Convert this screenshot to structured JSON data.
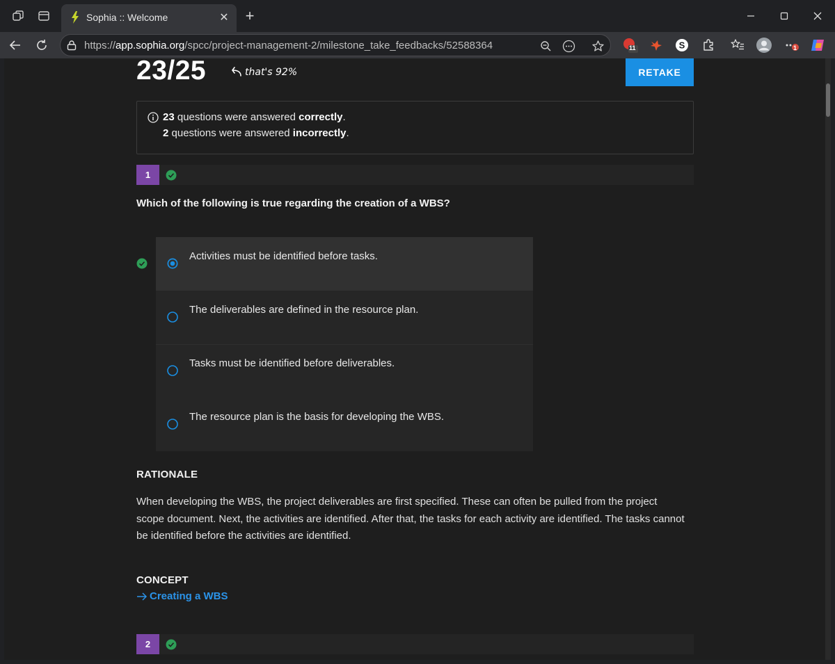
{
  "browser": {
    "tab_title": "Sophia :: Welcome",
    "url_prefix": "https://",
    "url_host": "app.sophia.org",
    "url_path": "/spcc/project-management-2/milestone_take_feedbacks/52588364",
    "extension_badge": "11",
    "menu_badge": "1"
  },
  "result": {
    "score": "23/25",
    "percent_note": "that's 92%",
    "retake_label": "RETAKE",
    "correct_count": "23",
    "correct_text": " questions were answered ",
    "correct_word": "correctly",
    "incorrect_count": "2",
    "incorrect_text": " questions were answered ",
    "incorrect_word": "incorrectly",
    "period": "."
  },
  "question": {
    "number": "1",
    "text": "Which of the following is true regarding the creation of a WBS?",
    "options": [
      {
        "label": "Activities must be identified before tasks.",
        "selected": true,
        "correct": true
      },
      {
        "label": "The deliverables are defined in the resource plan.",
        "selected": false
      },
      {
        "label": "Tasks must be identified before deliverables.",
        "selected": false
      },
      {
        "label": "The resource plan is the basis for developing the WBS.",
        "selected": false
      }
    ],
    "rationale_heading": "RATIONALE",
    "rationale": "When developing the WBS, the project deliverables are first specified. These can often be pulled from the project scope document. Next, the activities are identified. After that, the tasks for each activity are identified. The tasks cannot be identified before the activities are identified.",
    "concept_heading": "CONCEPT",
    "concept_link": "Creating a WBS"
  },
  "next_question": {
    "number": "2"
  },
  "colors": {
    "accent_blue": "#1a8fe3",
    "question_badge": "#7b46a6",
    "correct_green": "#2e9e57",
    "link": "#2b93e8"
  }
}
